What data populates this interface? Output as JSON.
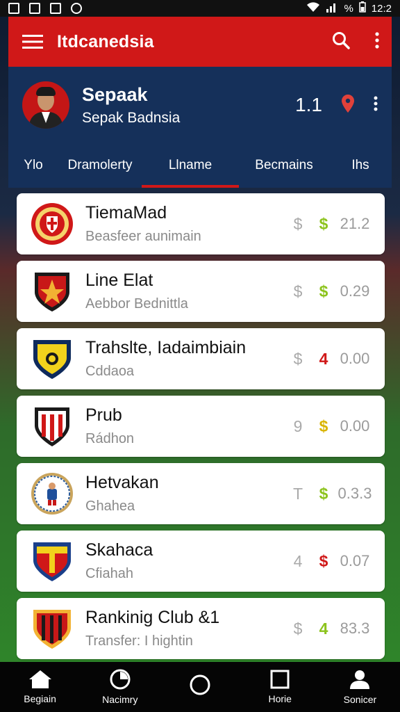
{
  "status": {
    "battery": "%",
    "time": "12:2"
  },
  "app": {
    "title": "Itdcanedsia"
  },
  "profile": {
    "name": "Sepaak",
    "subtitle": "Sepak Badnsia",
    "count": "1.1"
  },
  "tabs": [
    {
      "label": "Ylo"
    },
    {
      "label": "Dramolerty"
    },
    {
      "label": "Llname",
      "active": true
    },
    {
      "label": "Becmains"
    },
    {
      "label": "Ihs"
    }
  ],
  "clubs": [
    {
      "name": "TiemaMad",
      "subtitle": "Beasfeer aunimain",
      "sym1": "$",
      "sym2": "$",
      "value": "21.2",
      "sym2_color": "#8cc31c"
    },
    {
      "name": "Line Elat",
      "subtitle": "Aebbor Bednittla",
      "sym1": "$",
      "sym2": "$",
      "value": "0.29",
      "sym2_color": "#8cc31c"
    },
    {
      "name": "Trahslte, Iadaimbiain",
      "subtitle": "Cddaoa",
      "sym1": "$",
      "sym2": "4",
      "value": "0.00",
      "sym2_color": "#d01818"
    },
    {
      "name": "Prub",
      "subtitle": "Rádhon",
      "sym1": "9",
      "sym2": "$",
      "value": "0.00",
      "sym2_color": "#d9b400"
    },
    {
      "name": "Hetvakan",
      "subtitle": "Ghahea",
      "sym1": "T",
      "sym2": "$",
      "value": "0.3.3",
      "sym2_color": "#8cc31c"
    },
    {
      "name": "Skahaca",
      "subtitle": "Cfiahah",
      "sym1": "4",
      "sym2": "$",
      "value": "0.07",
      "sym2_color": "#d01818"
    },
    {
      "name": "Rankinig Club &1",
      "subtitle": "Transfer: I hightin",
      "sym1": "$",
      "sym2": "4",
      "value": "83.3",
      "sym2_color": "#8cc31c"
    }
  ],
  "nav": [
    {
      "label": "Begiain",
      "icon": "home-icon"
    },
    {
      "label": "Nacimry",
      "icon": "ball-icon"
    },
    {
      "label": "",
      "icon": "circle-icon"
    },
    {
      "label": "Horie",
      "icon": "square-icon"
    },
    {
      "label": "Sonicer",
      "icon": "user-icon"
    }
  ],
  "colors": {
    "accent": "#d01818",
    "navy": "#15305a",
    "green": "#8cc31c"
  }
}
